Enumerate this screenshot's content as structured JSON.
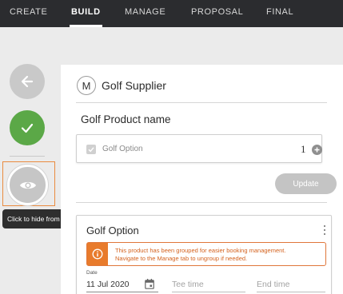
{
  "nav": {
    "tabs": [
      {
        "label": "CREATE",
        "active": false
      },
      {
        "label": "BUILD",
        "active": true
      },
      {
        "label": "MANAGE",
        "active": false
      },
      {
        "label": "PROPOSAL",
        "active": false
      },
      {
        "label": "FINAL",
        "active": false
      }
    ]
  },
  "rail": {
    "back_icon": "arrow-left-icon",
    "confirm_icon": "check-icon",
    "visibility_icon": "eye-icon"
  },
  "tooltip": {
    "text": "Click to hide from itinerary and itemised pricing"
  },
  "supplier": {
    "initial": "M",
    "name": "Golf Supplier"
  },
  "product": {
    "name": "Golf Product name",
    "option_label": "Golf Option",
    "quantity": "1",
    "update_label": "Update"
  },
  "option_card": {
    "title": "Golf Option",
    "notice_line1": "This product has been grouped for easier booking management.",
    "notice_line2": "Navigate to the Manage tab to ungroup if needed.",
    "date_label": "Date",
    "date_value": "11 Jul 2020",
    "tee_time_placeholder": "Tee time",
    "end_time_placeholder": "End time"
  },
  "colors": {
    "nav_bg": "#2b2c2f",
    "confirm_green": "#5ba847",
    "warning_orange": "#e87b2c",
    "highlight_outline": "#e98b3f"
  }
}
